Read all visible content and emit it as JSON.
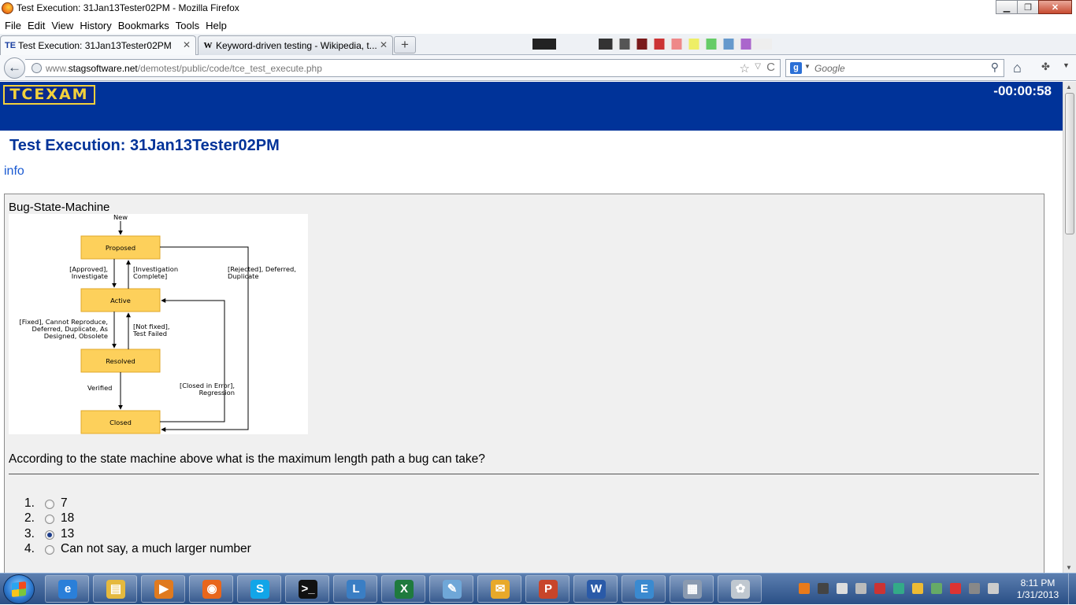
{
  "window": {
    "title": "Test Execution: 31Jan13Tester02PM - Mozilla Firefox",
    "minimize": "▁",
    "maximize": "❐",
    "close": "✕"
  },
  "menu": [
    "File",
    "Edit",
    "View",
    "History",
    "Bookmarks",
    "Tools",
    "Help"
  ],
  "tabs": [
    {
      "favicon": "TE",
      "label": "Test Execution: 31Jan13Tester02PM",
      "close": "✕"
    },
    {
      "favicon": "W",
      "label": "Keyword-driven testing - Wikipedia, t...",
      "close": "✕"
    }
  ],
  "new_tab": "+",
  "nav": {
    "back": "←",
    "url_prefix": "www.",
    "url_host": "stagsoftware.net",
    "url_path": "/demotest/public/code/tce_test_execute.php",
    "star": "☆",
    "dropdown": "▽",
    "reload": "C",
    "search_engine": "g",
    "search_placeholder": "Google",
    "search_icon": "⚲",
    "home": "⌂",
    "addon": "✤",
    "menu": "▼"
  },
  "page": {
    "logo": "TCEXAM",
    "timer": "-00:00:58",
    "title": "Test Execution: 31Jan13Tester02PM",
    "info_link": "info",
    "question_heading": "Bug-State-Machine",
    "question_text": "According to the state machine above what is the maximum length path a bug can take?",
    "answers": [
      {
        "num": "1.",
        "label": "7",
        "selected": false
      },
      {
        "num": "2.",
        "label": "18",
        "selected": false
      },
      {
        "num": "3.",
        "label": "13",
        "selected": true
      },
      {
        "num": "4.",
        "label": "Can not say, a much larger number",
        "selected": false
      }
    ]
  },
  "diagram": {
    "states": [
      "Proposed",
      "Active",
      "Resolved",
      "Closed"
    ],
    "labels": {
      "new": "New",
      "approved": [
        "[Approved],",
        "Investigate"
      ],
      "investigation": [
        "[Investigation",
        "Complete]"
      ],
      "rejected": [
        "[Rejected], Deferred,",
        "Duplicate"
      ],
      "fixed": [
        "[Fixed], Cannot Reproduce,",
        "Deferred, Duplicate, As",
        "Designed, Obsolete"
      ],
      "notfixed": [
        "[Not fixed],",
        "Test Failed"
      ],
      "verified": "Verified",
      "closed_error": [
        "[Closed in Error],",
        "Regression"
      ]
    },
    "box_color": "#fdd05b",
    "box_border": "#e0a72a"
  },
  "taskbar": {
    "apps": [
      {
        "name": "internet-explorer",
        "glyph": "e",
        "color": "#2a7fd9"
      },
      {
        "name": "file-explorer",
        "glyph": "▤",
        "color": "#e5b93e"
      },
      {
        "name": "media-player",
        "glyph": "▶",
        "color": "#e07a1f"
      },
      {
        "name": "firefox",
        "glyph": "◉",
        "color": "#e8661c"
      },
      {
        "name": "skype",
        "glyph": "S",
        "color": "#12a5e8"
      },
      {
        "name": "command-prompt",
        "glyph": ">_",
        "color": "#111111"
      },
      {
        "name": "lync",
        "glyph": "L",
        "color": "#3a7ec4"
      },
      {
        "name": "excel",
        "glyph": "X",
        "color": "#1f7a3e"
      },
      {
        "name": "notepad",
        "glyph": "✎",
        "color": "#6fa7d8"
      },
      {
        "name": "outlook",
        "glyph": "✉",
        "color": "#e8a92a"
      },
      {
        "name": "powerpoint",
        "glyph": "P",
        "color": "#c8452a"
      },
      {
        "name": "word",
        "glyph": "W",
        "color": "#2a5aa8"
      },
      {
        "name": "editor",
        "glyph": "E",
        "color": "#3a8ad0"
      },
      {
        "name": "calculator",
        "glyph": "▦",
        "color": "#8a9ab0"
      },
      {
        "name": "paint",
        "glyph": "✿",
        "color": "#c0c8d0"
      }
    ],
    "clock_time": "8:11 PM",
    "clock_date": "1/31/2013"
  }
}
